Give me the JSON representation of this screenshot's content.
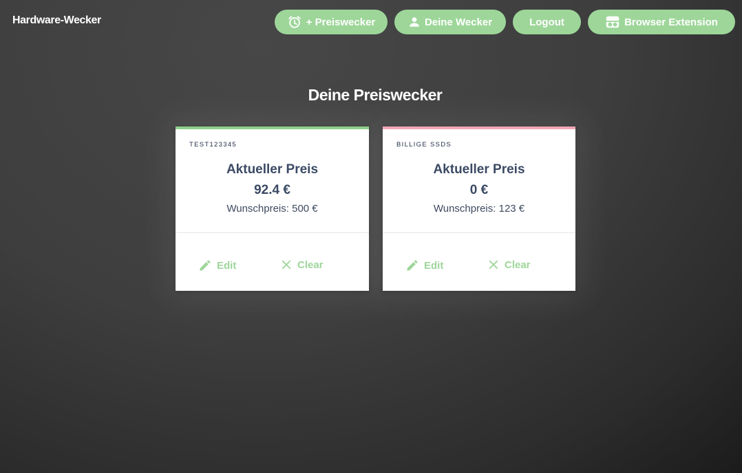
{
  "app": {
    "brand": "Hardware-Wecker"
  },
  "nav": {
    "add_alarm": "+ Preiswecker",
    "my_alarms": "Deine Wecker",
    "logout": "Logout",
    "extension": "Browser Extension",
    "icons": {
      "add_alarm": "alarm-clock-icon",
      "my_alarms": "user-icon",
      "extension": "extension-icon"
    }
  },
  "page": {
    "title": "Deine Preiswecker"
  },
  "cards": [
    {
      "name": "TEST123345",
      "heading": "Aktueller Preis",
      "price": "92.4 €",
      "wish": "Wunschpreis: 500 €",
      "edit": "Edit",
      "clear": "Clear",
      "accent": "#8fcf8a"
    },
    {
      "name": "BILLIGE SSDS",
      "heading": "Aktueller Preis",
      "price": "0 €",
      "wish": "Wunschpreis: 123 €",
      "edit": "Edit",
      "clear": "Clear",
      "accent": "#f3a6b6"
    }
  ],
  "colors": {
    "button_green": "#9ed69a",
    "text_dark": "#3b4a64"
  }
}
